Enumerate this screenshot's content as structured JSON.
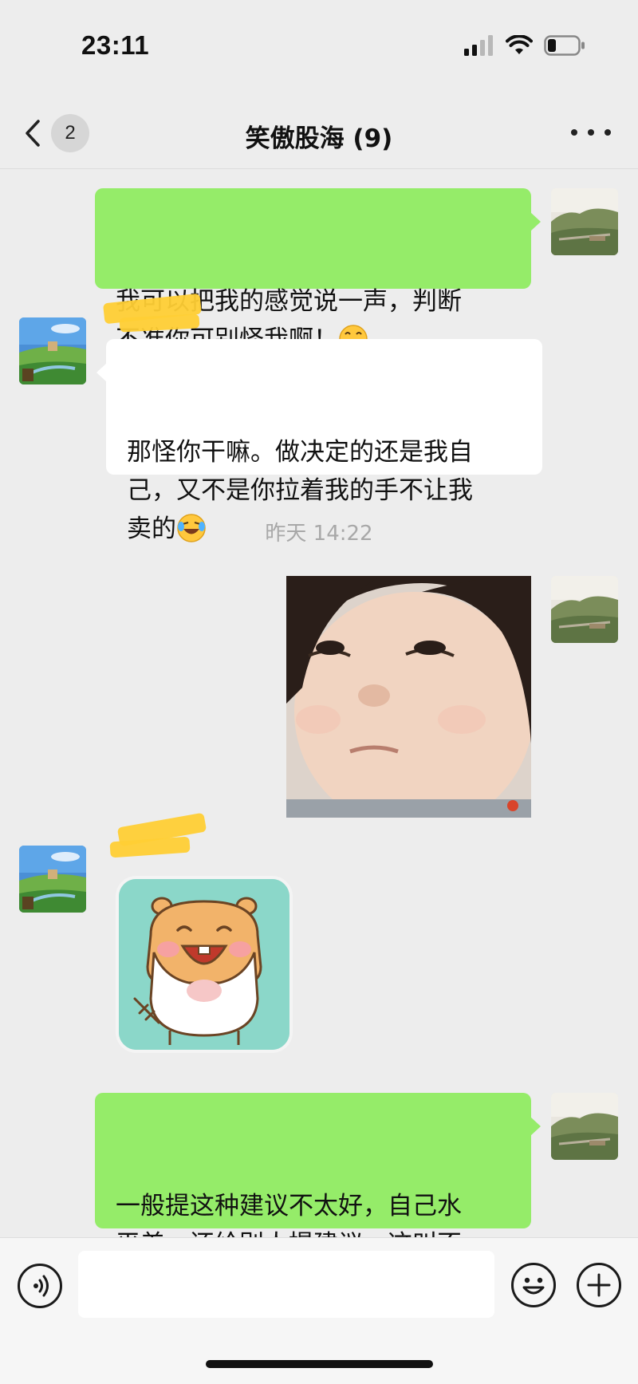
{
  "status_bar": {
    "time": "23:11",
    "icons": [
      "signal-icon",
      "wifi-icon",
      "battery-icon"
    ]
  },
  "nav": {
    "back_icon": "chevron-left-icon",
    "unread_count": "2",
    "title": "笑傲股海 (9)",
    "more_icon": "more-icon"
  },
  "messages": [
    {
      "direction": "out",
      "type": "text",
      "text": "我可以把我的感觉说一声，判断\n不准你可别怪我啊！",
      "trailing_emoji": "grin-emoji"
    },
    {
      "direction": "in",
      "type": "text",
      "text": "那怪你干嘛。做决定的还是我自\n己，又不是你拉着我的手不让我\n卖的",
      "trailing_emoji": "laugh-cry-emoji"
    },
    {
      "direction": "system",
      "type": "timestamp",
      "text": "昨天 14:22"
    },
    {
      "direction": "out",
      "type": "image",
      "description": "photo-of-child"
    },
    {
      "direction": "in",
      "type": "sticker",
      "description": "laughing-hamster-sticker"
    },
    {
      "direction": "out",
      "type": "text",
      "text": "一般提这种建议不太好，自己水\n平差，还给别人提建议，这叫不\n自量力",
      "trailing_emoji": "grin-emoji"
    }
  ],
  "input_bar": {
    "voice_icon": "voice-icon",
    "input_value": "",
    "emoji_icon": "emoji-icon",
    "plus_icon": "plus-icon"
  },
  "colors": {
    "background": "#ededed",
    "outgoing_bubble": "#95ec69",
    "incoming_bubble": "#ffffff",
    "redaction": "#ffcf35"
  }
}
